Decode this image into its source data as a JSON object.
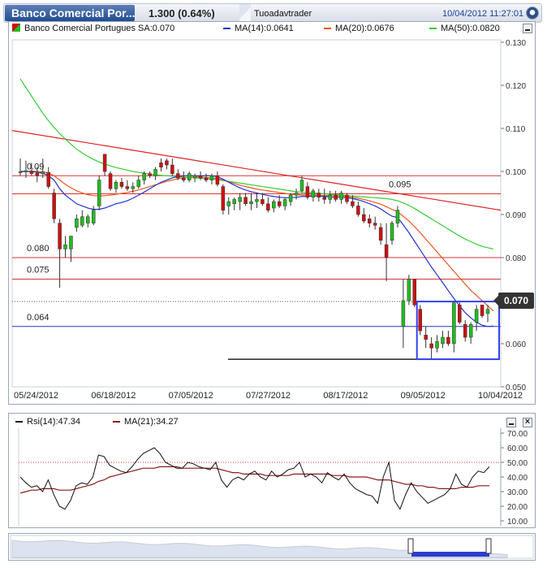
{
  "titlebar": {
    "symbol": "Banco Comercial Por...",
    "price_change": "1.300 (0.64%)",
    "user": "Tuoadavtrader",
    "datetime": "10/04/2012 11:27:01"
  },
  "main_legend": {
    "symbol_label": "Banco Comercial Portugues SA:0.070",
    "ma14_label": "MA(14):0.0641",
    "ma20_label": "MA(20):0.0676",
    "ma50_label": "MA(50):0.0820"
  },
  "rsi_legend": {
    "rsi_label": "Rsi(14):47.34",
    "ma21_label": "MA(21):34.27"
  },
  "colors": {
    "up": "#22bb22",
    "down": "#cc1111",
    "ma14": "#2233cc",
    "ma20": "#ee5522",
    "ma50": "#33cc33",
    "trend": "#dd2222",
    "hline": "#dd3333",
    "box": "#3344ee",
    "rsi": "#111111",
    "rsi_ma": "#8b1a1a"
  },
  "last_price_badge": "0.070",
  "chart_data": [
    {
      "type": "candlestick",
      "title": "Banco Comercial Portugues SA",
      "y_ticks": [
        "0.130",
        "0.120",
        "0.110",
        "0.100",
        "0.090",
        "0.080",
        "0.070",
        "0.060",
        "0.050"
      ],
      "ylim": [
        0.05,
        0.13
      ],
      "x_ticks": [
        "05/24/2012",
        "06/18/2012",
        "07/05/2012",
        "07/27/2012",
        "08/17/2012",
        "09/05/2012",
        "10/04/2012"
      ],
      "level_labels": [
        "0.09",
        "0.095",
        "0.080",
        "0.075",
        "0.064"
      ],
      "levels": [
        0.099,
        0.0948,
        0.08,
        0.075,
        0.0698,
        0.064,
        0.0564
      ],
      "candles": [
        {
          "o": 0.0997,
          "h": 0.103,
          "l": 0.099,
          "c": 0.0999
        },
        {
          "o": 0.0999,
          "h": 0.1025,
          "l": 0.0985,
          "c": 0.1002
        },
        {
          "o": 0.1001,
          "h": 0.102,
          "l": 0.099,
          "c": 0.0995
        },
        {
          "o": 0.0996,
          "h": 0.101,
          "l": 0.0975,
          "c": 0.099
        },
        {
          "o": 0.0995,
          "h": 0.103,
          "l": 0.0985,
          "c": 0.0999
        },
        {
          "o": 0.0998,
          "h": 0.101,
          "l": 0.096,
          "c": 0.0965
        },
        {
          "o": 0.095,
          "h": 0.096,
          "l": 0.088,
          "c": 0.089
        },
        {
          "o": 0.088,
          "h": 0.089,
          "l": 0.073,
          "c": 0.082
        },
        {
          "o": 0.082,
          "h": 0.085,
          "l": 0.08,
          "c": 0.083
        },
        {
          "o": 0.082,
          "h": 0.085,
          "l": 0.079,
          "c": 0.085
        },
        {
          "o": 0.087,
          "h": 0.09,
          "l": 0.086,
          "c": 0.089
        },
        {
          "o": 0.0875,
          "h": 0.091,
          "l": 0.087,
          "c": 0.0895
        },
        {
          "o": 0.088,
          "h": 0.09,
          "l": 0.087,
          "c": 0.0895
        },
        {
          "o": 0.088,
          "h": 0.092,
          "l": 0.0875,
          "c": 0.091
        },
        {
          "o": 0.092,
          "h": 0.099,
          "l": 0.091,
          "c": 0.098
        },
        {
          "o": 0.104,
          "h": 0.104,
          "l": 0.099,
          "c": 0.1
        },
        {
          "o": 0.0995,
          "h": 0.1,
          "l": 0.0955,
          "c": 0.096
        },
        {
          "o": 0.096,
          "h": 0.098,
          "l": 0.095,
          "c": 0.0975
        },
        {
          "o": 0.0975,
          "h": 0.0985,
          "l": 0.096,
          "c": 0.0965
        },
        {
          "o": 0.0965,
          "h": 0.098,
          "l": 0.0955,
          "c": 0.096
        },
        {
          "o": 0.096,
          "h": 0.0975,
          "l": 0.095,
          "c": 0.0965
        },
        {
          "o": 0.0965,
          "h": 0.099,
          "l": 0.096,
          "c": 0.098
        },
        {
          "o": 0.098,
          "h": 0.1,
          "l": 0.097,
          "c": 0.0995
        },
        {
          "o": 0.0995,
          "h": 0.1,
          "l": 0.0985,
          "c": 0.099
        },
        {
          "o": 0.099,
          "h": 0.101,
          "l": 0.098,
          "c": 0.1005
        },
        {
          "o": 0.102,
          "h": 0.103,
          "l": 0.1,
          "c": 0.101
        },
        {
          "o": 0.1025,
          "h": 0.103,
          "l": 0.1005,
          "c": 0.1015
        },
        {
          "o": 0.1015,
          "h": 0.103,
          "l": 0.099,
          "c": 0.0995
        },
        {
          "o": 0.0995,
          "h": 0.1005,
          "l": 0.098,
          "c": 0.0985
        },
        {
          "o": 0.0985,
          "h": 0.1,
          "l": 0.0975,
          "c": 0.098
        },
        {
          "o": 0.098,
          "h": 0.1,
          "l": 0.0975,
          "c": 0.0995
        },
        {
          "o": 0.0985,
          "h": 0.0995,
          "l": 0.0975,
          "c": 0.099
        },
        {
          "o": 0.099,
          "h": 0.1,
          "l": 0.098,
          "c": 0.0985
        },
        {
          "o": 0.0985,
          "h": 0.0995,
          "l": 0.0975,
          "c": 0.098
        },
        {
          "o": 0.098,
          "h": 0.0995,
          "l": 0.097,
          "c": 0.099
        },
        {
          "o": 0.099,
          "h": 0.1,
          "l": 0.0965,
          "c": 0.097
        },
        {
          "o": 0.0965,
          "h": 0.097,
          "l": 0.09,
          "c": 0.091
        },
        {
          "o": 0.092,
          "h": 0.094,
          "l": 0.09,
          "c": 0.093
        },
        {
          "o": 0.0925,
          "h": 0.094,
          "l": 0.091,
          "c": 0.0935
        },
        {
          "o": 0.093,
          "h": 0.095,
          "l": 0.091,
          "c": 0.094
        },
        {
          "o": 0.094,
          "h": 0.095,
          "l": 0.092,
          "c": 0.0925
        },
        {
          "o": 0.0925,
          "h": 0.095,
          "l": 0.091,
          "c": 0.093
        },
        {
          "o": 0.093,
          "h": 0.095,
          "l": 0.0915,
          "c": 0.0935
        },
        {
          "o": 0.0935,
          "h": 0.095,
          "l": 0.092,
          "c": 0.0925
        },
        {
          "o": 0.0925,
          "h": 0.094,
          "l": 0.0905,
          "c": 0.091
        },
        {
          "o": 0.0915,
          "h": 0.0935,
          "l": 0.0905,
          "c": 0.093
        },
        {
          "o": 0.093,
          "h": 0.0945,
          "l": 0.0915,
          "c": 0.092
        },
        {
          "o": 0.092,
          "h": 0.094,
          "l": 0.091,
          "c": 0.0935
        },
        {
          "o": 0.093,
          "h": 0.095,
          "l": 0.092,
          "c": 0.0945
        },
        {
          "o": 0.0945,
          "h": 0.096,
          "l": 0.0935,
          "c": 0.095
        },
        {
          "o": 0.0955,
          "h": 0.099,
          "l": 0.095,
          "c": 0.098
        },
        {
          "o": 0.0965,
          "h": 0.0975,
          "l": 0.0935,
          "c": 0.094
        },
        {
          "o": 0.094,
          "h": 0.096,
          "l": 0.093,
          "c": 0.0955
        },
        {
          "o": 0.095,
          "h": 0.096,
          "l": 0.093,
          "c": 0.094
        },
        {
          "o": 0.094,
          "h": 0.096,
          "l": 0.0925,
          "c": 0.0935
        },
        {
          "o": 0.0935,
          "h": 0.0955,
          "l": 0.0925,
          "c": 0.0945
        },
        {
          "o": 0.0945,
          "h": 0.0955,
          "l": 0.093,
          "c": 0.0935
        },
        {
          "o": 0.0935,
          "h": 0.0955,
          "l": 0.0925,
          "c": 0.095
        },
        {
          "o": 0.0945,
          "h": 0.095,
          "l": 0.0925,
          "c": 0.093
        },
        {
          "o": 0.093,
          "h": 0.0945,
          "l": 0.0915,
          "c": 0.092
        },
        {
          "o": 0.092,
          "h": 0.093,
          "l": 0.0895,
          "c": 0.09
        },
        {
          "o": 0.09,
          "h": 0.0915,
          "l": 0.088,
          "c": 0.0885
        },
        {
          "o": 0.089,
          "h": 0.09,
          "l": 0.087,
          "c": 0.088
        },
        {
          "o": 0.088,
          "h": 0.0895,
          "l": 0.0865,
          "c": 0.0875
        },
        {
          "o": 0.087,
          "h": 0.088,
          "l": 0.083,
          "c": 0.084
        },
        {
          "o": 0.083,
          "h": 0.088,
          "l": 0.0745,
          "c": 0.08
        },
        {
          "o": 0.084,
          "h": 0.0885,
          "l": 0.083,
          "c": 0.088
        },
        {
          "o": 0.088,
          "h": 0.092,
          "l": 0.087,
          "c": 0.091
        },
        {
          "o": 0.064,
          "h": 0.075,
          "l": 0.059,
          "c": 0.07
        },
        {
          "o": 0.07,
          "h": 0.076,
          "l": 0.069,
          "c": 0.075
        },
        {
          "o": 0.075,
          "h": 0.075,
          "l": 0.0685,
          "c": 0.069
        },
        {
          "o": 0.068,
          "h": 0.069,
          "l": 0.062,
          "c": 0.063
        },
        {
          "o": 0.062,
          "h": 0.064,
          "l": 0.059,
          "c": 0.061
        },
        {
          "o": 0.06,
          "h": 0.0615,
          "l": 0.0565,
          "c": 0.059
        },
        {
          "o": 0.059,
          "h": 0.062,
          "l": 0.058,
          "c": 0.0605
        },
        {
          "o": 0.06,
          "h": 0.063,
          "l": 0.059,
          "c": 0.0615
        },
        {
          "o": 0.0615,
          "h": 0.063,
          "l": 0.0595,
          "c": 0.06
        },
        {
          "o": 0.06,
          "h": 0.07,
          "l": 0.058,
          "c": 0.0695
        },
        {
          "o": 0.069,
          "h": 0.07,
          "l": 0.0645,
          "c": 0.065
        },
        {
          "o": 0.0645,
          "h": 0.0655,
          "l": 0.0605,
          "c": 0.0615
        },
        {
          "o": 0.0615,
          "h": 0.065,
          "l": 0.06,
          "c": 0.0645
        },
        {
          "o": 0.065,
          "h": 0.069,
          "l": 0.063,
          "c": 0.068
        },
        {
          "o": 0.069,
          "h": 0.069,
          "l": 0.066,
          "c": 0.0665
        },
        {
          "o": 0.067,
          "h": 0.069,
          "l": 0.065,
          "c": 0.068
        }
      ],
      "ma14": [
        0.1,
        0.1,
        0.1,
        0.0998,
        0.0996,
        0.099,
        0.098,
        0.096,
        0.0945,
        0.0935,
        0.0925,
        0.092,
        0.0915,
        0.0912,
        0.0912,
        0.0915,
        0.092,
        0.0925,
        0.0928,
        0.0932,
        0.0938,
        0.0945,
        0.0952,
        0.096,
        0.0968,
        0.0975,
        0.098,
        0.0985,
        0.0988,
        0.099,
        0.099,
        0.099,
        0.099,
        0.099,
        0.099,
        0.0988,
        0.0982,
        0.0975,
        0.0968,
        0.0962,
        0.0957,
        0.0953,
        0.095,
        0.0947,
        0.0944,
        0.0942,
        0.094,
        0.0939,
        0.0939,
        0.094,
        0.0942,
        0.0942,
        0.0943,
        0.0943,
        0.0942,
        0.0941,
        0.094,
        0.094,
        0.0939,
        0.0937,
        0.0934,
        0.093,
        0.0925,
        0.092,
        0.0913,
        0.0904,
        0.0896,
        0.0893,
        0.0876,
        0.0858,
        0.0838,
        0.0818,
        0.0798,
        0.0778,
        0.076,
        0.0742,
        0.0723,
        0.0705,
        0.0688,
        0.0672,
        0.066,
        0.065,
        0.0643,
        0.064,
        0.0641
      ],
      "ma20": [
        0.1,
        0.1,
        0.1,
        0.1,
        0.0999,
        0.0996,
        0.099,
        0.098,
        0.097,
        0.0962,
        0.0955,
        0.095,
        0.0946,
        0.0944,
        0.0943,
        0.0944,
        0.0945,
        0.0947,
        0.0949,
        0.0951,
        0.0954,
        0.0957,
        0.0961,
        0.0965,
        0.0969,
        0.0973,
        0.0977,
        0.098,
        0.0983,
        0.0985,
        0.0986,
        0.0987,
        0.0987,
        0.0986,
        0.0985,
        0.0983,
        0.098,
        0.0976,
        0.0972,
        0.0968,
        0.0965,
        0.0962,
        0.0959,
        0.0957,
        0.0955,
        0.0953,
        0.0951,
        0.0949,
        0.0947,
        0.0946,
        0.0945,
        0.0945,
        0.0945,
        0.0945,
        0.0944,
        0.0944,
        0.0943,
        0.0943,
        0.0942,
        0.094,
        0.0938,
        0.0935,
        0.0932,
        0.0928,
        0.0924,
        0.0918,
        0.0912,
        0.0906,
        0.0896,
        0.0885,
        0.0872,
        0.0858,
        0.0843,
        0.0828,
        0.0813,
        0.0798,
        0.0783,
        0.0768,
        0.0753,
        0.0738,
        0.0724,
        0.0712,
        0.07,
        0.0688,
        0.0676
      ],
      "ma50": [
        0.1215,
        0.1195,
        0.1175,
        0.1155,
        0.1135,
        0.1118,
        0.1102,
        0.1088,
        0.1075,
        0.1063,
        0.1052,
        0.1043,
        0.1035,
        0.1028,
        0.1022,
        0.1017,
        0.1013,
        0.1009,
        0.1006,
        0.1003,
        0.1,
        0.0998,
        0.0996,
        0.0994,
        0.0992,
        0.0991,
        0.099,
        0.0989,
        0.0988,
        0.0987,
        0.0986,
        0.0985,
        0.0984,
        0.0983,
        0.0982,
        0.0981,
        0.0979,
        0.0977,
        0.0975,
        0.0973,
        0.0971,
        0.0969,
        0.0967,
        0.0965,
        0.0963,
        0.0961,
        0.0959,
        0.0957,
        0.0955,
        0.0953,
        0.0952,
        0.0951,
        0.095,
        0.0949,
        0.0948,
        0.0947,
        0.0946,
        0.0945,
        0.0944,
        0.0943,
        0.0942,
        0.0941,
        0.094,
        0.0939,
        0.0938,
        0.0937,
        0.0935,
        0.0932,
        0.0927,
        0.0921,
        0.0914,
        0.0906,
        0.0898,
        0.089,
        0.0882,
        0.0874,
        0.0866,
        0.0858,
        0.085,
        0.0843,
        0.0837,
        0.0831,
        0.0826,
        0.0823,
        0.082
      ],
      "trendline": [
        [
          0,
          0.1095
        ],
        [
          84,
          0.091
        ]
      ]
    },
    {
      "type": "line",
      "title": "Rsi(14)",
      "y_ticks": [
        "70.00",
        "60.00",
        "50.00",
        "40.00",
        "30.00",
        "20.00",
        "10.00"
      ],
      "ylim": [
        10,
        70
      ],
      "reference_level": 50,
      "series": [
        {
          "name": "Rsi(14)",
          "values": [
            40,
            36,
            33,
            34,
            30,
            38,
            28,
            20,
            18,
            24,
            34,
            36,
            35,
            40,
            55,
            54,
            48,
            46,
            44,
            43,
            47,
            52,
            56,
            58,
            60,
            56,
            50,
            48,
            46,
            46,
            50,
            49,
            47,
            46,
            45,
            50,
            38,
            33,
            38,
            40,
            38,
            42,
            44,
            40,
            38,
            44,
            40,
            42,
            45,
            46,
            50,
            40,
            42,
            40,
            36,
            43,
            40,
            38,
            42,
            36,
            32,
            30,
            28,
            27,
            22,
            40,
            50,
            24,
            18,
            28,
            36,
            30,
            26,
            22,
            24,
            26,
            28,
            32,
            42,
            35,
            33,
            40,
            44,
            43,
            47
          ]
        },
        {
          "name": "MA(21)",
          "values": [
            29,
            30,
            31,
            31,
            32,
            32,
            32,
            31,
            31,
            31,
            32,
            33,
            34,
            35,
            37,
            38,
            40,
            41,
            42,
            43,
            44,
            45,
            46,
            46,
            46,
            47,
            47,
            47,
            47,
            46,
            46,
            46,
            46,
            46,
            46,
            46,
            45,
            44,
            43,
            43,
            42,
            42,
            42,
            42,
            41,
            41,
            41,
            41,
            41,
            42,
            42,
            42,
            42,
            42,
            42,
            42,
            41,
            41,
            41,
            40,
            40,
            40,
            40,
            39,
            38,
            38,
            38,
            37,
            36,
            35,
            35,
            34,
            34,
            33,
            33,
            32,
            32,
            32,
            32,
            33,
            33,
            33,
            34,
            34,
            34
          ]
        }
      ]
    }
  ]
}
